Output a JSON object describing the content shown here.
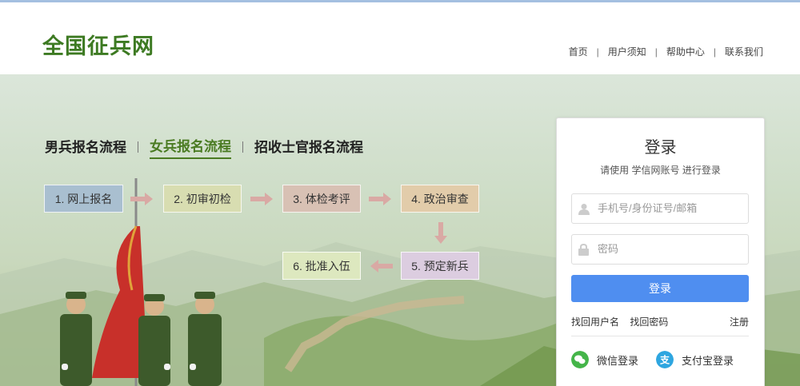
{
  "header": {
    "logo": "全国征兵网",
    "nav": [
      "首页",
      "用户须知",
      "帮助中心",
      "联系我们"
    ]
  },
  "tabs": [
    "男兵报名流程",
    "女兵报名流程",
    "招收士官报名流程"
  ],
  "active_tab": 1,
  "steps": [
    {
      "label": "1. 网上报名",
      "color": "#a9bfd0"
    },
    {
      "label": "2. 初审初检",
      "color": "#d8ddb1"
    },
    {
      "label": "3. 体检考评",
      "color": "#d8c1b4"
    },
    {
      "label": "4. 政治审查",
      "color": "#e2ccaa"
    },
    {
      "label": "5. 预定新兵",
      "color": "#dccde0"
    },
    {
      "label": "6. 批准入伍",
      "color": "#dde8bf"
    }
  ],
  "login": {
    "title": "登录",
    "subtitle": "请使用 学信网账号 进行登录",
    "username_placeholder": "手机号/身份证号/邮箱",
    "password_placeholder": "密码",
    "submit": "登录",
    "find_username": "找回用户名",
    "find_password": "找回密码",
    "register": "注册",
    "wechat": "微信登录",
    "alipay": "支付宝登录"
  },
  "colors": {
    "accent_green": "#4a7b22",
    "login_button": "#4f8ef0",
    "wechat": "#44b549",
    "alipay": "#2ea6e0"
  }
}
